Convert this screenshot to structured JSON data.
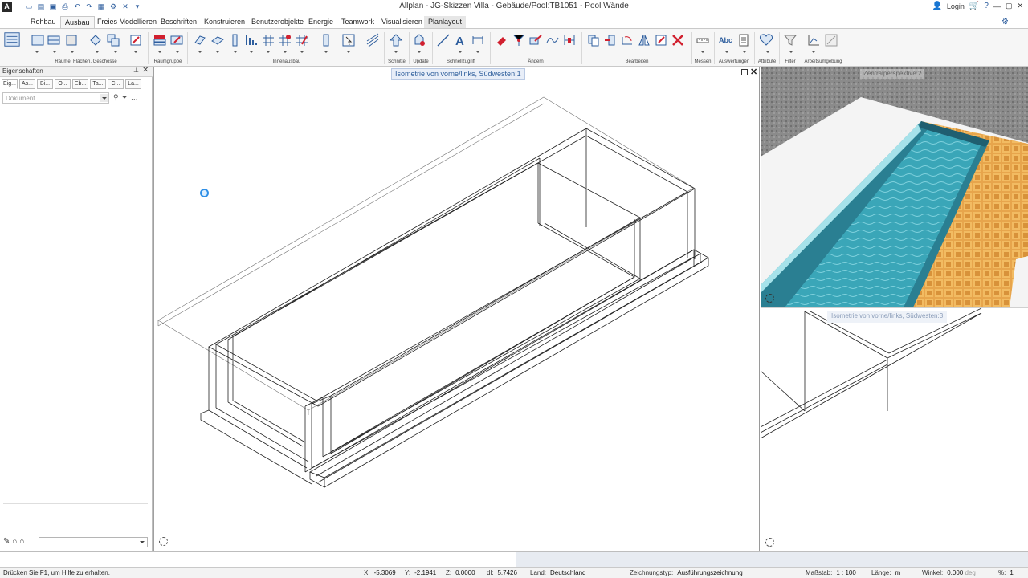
{
  "window": {
    "title": "Allplan - JG-Skizzen Villa - Gebäude/Pool:TB1051 - Pool Wände",
    "logo": "A",
    "login_label": "Login"
  },
  "ribbon": {
    "tabs": [
      {
        "label": "Rohbau"
      },
      {
        "label": "Ausbau"
      },
      {
        "label": "Freies Modellieren"
      },
      {
        "label": "Beschriften"
      },
      {
        "label": "Konstruieren"
      },
      {
        "label": "Benutzerobjekte"
      },
      {
        "label": "Energie"
      },
      {
        "label": "Teamwork"
      },
      {
        "label": "Visualisieren"
      },
      {
        "label": "Planlayout"
      }
    ],
    "active_tab": "Ausbau",
    "groups": [
      {
        "label": "Räume, Flächen, Geschosse"
      },
      {
        "label": "Raumgruppe"
      },
      {
        "label": "Innenausbau"
      },
      {
        "label": "Schnitte"
      },
      {
        "label": "Update"
      },
      {
        "label": "Schnellzugriff"
      },
      {
        "label": "Ändern"
      },
      {
        "label": "Bearbeiten"
      },
      {
        "label": "Messen"
      },
      {
        "label": "Auswertungen"
      },
      {
        "label": "Attribute"
      },
      {
        "label": "Filter"
      },
      {
        "label": "Arbeitsumgebung"
      }
    ],
    "abc_label": "Abc"
  },
  "properties_panel": {
    "title": "Eigenschaften",
    "tabs": [
      {
        "label": "Eig..."
      },
      {
        "label": "As..."
      },
      {
        "label": "Bi..."
      },
      {
        "label": "O..."
      },
      {
        "label": "Eb..."
      },
      {
        "label": "Ta..."
      },
      {
        "label": "C..."
      },
      {
        "label": "La..."
      }
    ],
    "document_placeholder": "Dokument"
  },
  "viewports": {
    "main_label": "Isometrie von vorne/links, Südwesten:1",
    "perspective_label": "Zentralperspektive:2",
    "iso2_label": "Isometrie von vorne/links, Südwesten:3"
  },
  "commandline": {
    "hint": "Drücken Sie F1, um Hilfe zu erhalten."
  },
  "statusbar": {
    "x_label": "X:",
    "x_value": "-5.3069",
    "y_label": "Y:",
    "y_value": "-2.1941",
    "z_label": "Z:",
    "z_value": "0.0000",
    "dl_label": "dl:",
    "dl_value": "5.7426",
    "land_label": "Land:",
    "land_value": "Deutschland",
    "zeichnungstyp_label": "Zeichnungstyp:",
    "zeichnungstyp_value": "Ausführungszeichnung",
    "massstab_label": "Maßstab:",
    "massstab_value": "1 : 100",
    "laenge_label": "Länge:",
    "laenge_value": "m",
    "winkel_label": "Winkel:",
    "winkel_value": "0.000",
    "winkel_unit": "deg",
    "percent_label": "%:",
    "percent_value": "1"
  },
  "colors": {
    "accent": "#2e5e9e",
    "ribbon_bg": "#f6f6f6",
    "water": "#3aa6b8",
    "tiles": "#e5a24a"
  }
}
